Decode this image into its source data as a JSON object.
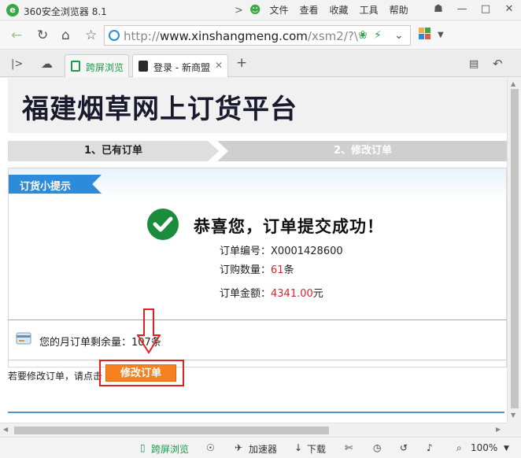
{
  "window": {
    "title": "360安全浏览器 8.1",
    "menu": [
      "文件",
      "查看",
      "收藏",
      "工具",
      "帮助"
    ]
  },
  "address": {
    "url_prefix": "http://",
    "url_host": "www.xinshangmeng.com",
    "url_path": "/xsm2/?\\"
  },
  "tabs": [
    {
      "label": "跨屏浏览"
    },
    {
      "label": "登录 - 新商盟"
    }
  ],
  "page": {
    "title": "福建烟草网上订货平台",
    "steps": [
      "1、已有订单",
      "2、修改订单"
    ],
    "tip_label": "订货小提示",
    "success_message": "恭喜您，订单提交成功！",
    "order_no_label": "订单编号：",
    "order_no": "X0001428600",
    "quantity_label": "订购数量：",
    "quantity": "61",
    "quantity_unit": "条",
    "amount_label": "订单金额：",
    "amount": "4341.00",
    "amount_unit": "元",
    "quota_label": "您的月订单剩余量：",
    "quota_value": "107",
    "quota_unit": "条",
    "modify_hint": "若要修改订单，请点击",
    "modify_button": "修改订单"
  },
  "statusbar": {
    "cross_screen": "跨屏浏览",
    "accelerator": "加速器",
    "download": "下载",
    "zoom": "100%"
  },
  "colors": {
    "brand_green": "#3aa846",
    "tip_blue": "#2d8bdc",
    "success_green": "#1b8c3c",
    "value_red": "#d8262b",
    "button_orange": "#f58220",
    "highlight_red": "#e02020"
  }
}
